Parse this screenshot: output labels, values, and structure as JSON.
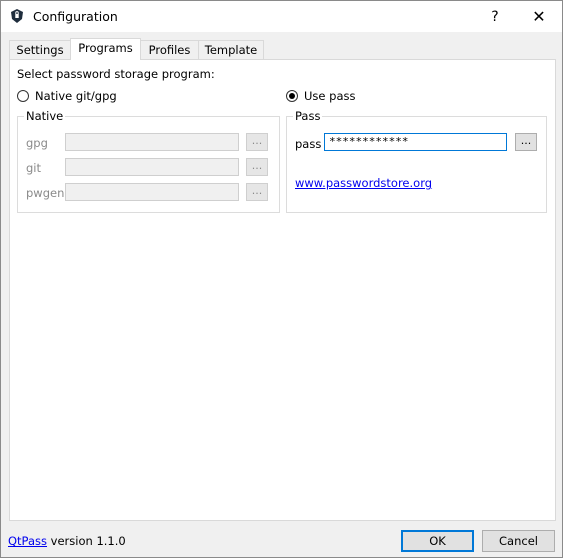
{
  "window": {
    "title": "Configuration",
    "help_label": "?",
    "close_label": "✕"
  },
  "tabs": [
    {
      "label": "Settings"
    },
    {
      "label": "Programs",
      "active": true
    },
    {
      "label": "Profiles"
    },
    {
      "label": "Template"
    }
  ],
  "programs": {
    "prompt": "Select password storage program:",
    "native_radio_label": "Native git/gpg",
    "pass_radio_label": "Use pass",
    "native_group": {
      "title": "Native",
      "fields": [
        {
          "label": "gpg",
          "value": ""
        },
        {
          "label": "git",
          "value": ""
        },
        {
          "label": "pwgen",
          "value": ""
        }
      ],
      "browse_label": "..."
    },
    "pass_group": {
      "title": "Pass",
      "field_label": "pass",
      "field_value": "************",
      "browse_label": "...",
      "link_text": "www.passwordstore.org"
    }
  },
  "footer": {
    "app_link": "QtPass",
    "version_text": " version 1.1.0",
    "ok_label": "OK",
    "cancel_label": "Cancel"
  },
  "colors": {
    "accent": "#0078d7",
    "link": "#0000ee"
  }
}
